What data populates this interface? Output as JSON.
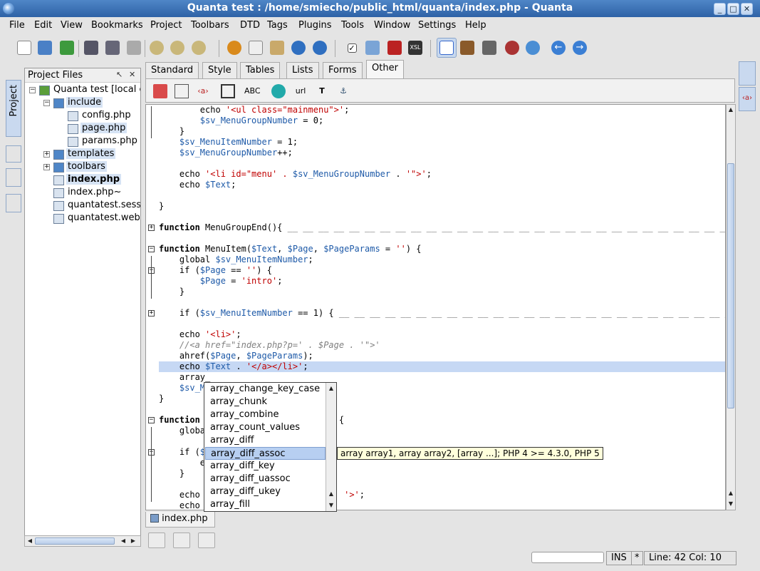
{
  "window": {
    "title": "Quanta test : /home/smiecho/public_html/quanta/index.php - Quanta"
  },
  "menu": [
    "File",
    "Edit",
    "View",
    "Bookmarks",
    "Project",
    "Toolbars",
    "DTD",
    "Tags",
    "Plugins",
    "Tools",
    "Window",
    "Settings",
    "Help"
  ],
  "toolbar": {
    "buttons": [
      "new-file-icon",
      "open-file-icon",
      "open-project-icon",
      "save-icon",
      "save-all-icon",
      "print-icon",
      "find-icon",
      "zoom-in-icon",
      "zoom-out-icon",
      "cut-icon",
      "copy-icon",
      "paste-icon",
      "undo-icon",
      "redo-icon",
      "checkbox-icon",
      "preview-icon",
      "table-icon",
      "xsl-icon",
      "page-icon",
      "view-icon",
      "layout-icon",
      "eye-icon",
      "reload-icon",
      "back-icon",
      "forward-icon"
    ]
  },
  "left_panel": {
    "vertical_tab": "Project",
    "header": "Project Files",
    "tree": [
      {
        "label": "Quanta test [local c",
        "level": 0,
        "expander": "−"
      },
      {
        "label": "include",
        "level": 1,
        "expander": "−"
      },
      {
        "label": "config.php",
        "level": 2
      },
      {
        "label": "page.php",
        "level": 2
      },
      {
        "label": "params.php",
        "level": 2
      },
      {
        "label": "templates",
        "level": 1,
        "expander": "+"
      },
      {
        "label": "toolbars",
        "level": 1,
        "expander": "+"
      },
      {
        "label": "index.php",
        "level": 1,
        "bold": true
      },
      {
        "label": "index.php~",
        "level": 1
      },
      {
        "label": "quantatest.sess",
        "level": 1
      },
      {
        "label": "quantatest.webp",
        "level": 1
      }
    ]
  },
  "tag_tabs": [
    "Standard",
    "Style",
    "Tables",
    "Lists",
    "Forms",
    "Other"
  ],
  "active_tab": "Other",
  "tag_toolbar": [
    "ABC",
    "url",
    "T"
  ],
  "code_lines": [
    [
      [
        "        echo ",
        ""
      ],
      [
        "'<ul class=\"mainmenu\">'",
        "str"
      ],
      [
        ";",
        ""
      ]
    ],
    [
      [
        "        ",
        ""
      ],
      [
        "$sv_MenuGroupNumber",
        "var"
      ],
      [
        " = 0;",
        ""
      ]
    ],
    [
      [
        "    }",
        ""
      ]
    ],
    [
      [
        "    ",
        ""
      ],
      [
        "$sv_MenuItemNumber",
        "var"
      ],
      [
        " = 1;",
        ""
      ]
    ],
    [
      [
        "    ",
        ""
      ],
      [
        "$sv_MenuGroupNumber",
        "var"
      ],
      [
        "++;",
        ""
      ]
    ],
    [
      [
        "",
        ""
      ]
    ],
    [
      [
        "    echo ",
        ""
      ],
      [
        "'<li id=\"menu' . ",
        "str"
      ],
      [
        "$sv_MenuGroupNumber",
        "var"
      ],
      [
        " . ",
        ""
      ],
      [
        "'\">'",
        "str"
      ],
      [
        ";",
        ""
      ]
    ],
    [
      [
        "    echo ",
        ""
      ],
      [
        "$Text",
        "var"
      ],
      [
        ";",
        ""
      ]
    ],
    [
      [
        "",
        ""
      ]
    ],
    [
      [
        "}",
        ""
      ]
    ],
    [
      [
        "",
        ""
      ]
    ],
    [
      [
        "function",
        "kw"
      ],
      [
        " MenuGroupEnd(){",
        ""
      ],
      [
        " __ __ __ __ __ __ __ __ __ __ __ __ __ __ __ __ __ __ __ __ __ __ __ __ __ __ __ __ __ __ __ __",
        "dash"
      ]
    ],
    [
      [
        "",
        ""
      ]
    ],
    [
      [
        "function",
        "kw"
      ],
      [
        " MenuItem(",
        ""
      ],
      [
        "$Text",
        "var"
      ],
      [
        ", ",
        ""
      ],
      [
        "$Page",
        "var"
      ],
      [
        ", ",
        ""
      ],
      [
        "$PageParams",
        "var"
      ],
      [
        " = ",
        ""
      ],
      [
        "''",
        "str"
      ],
      [
        ") {",
        ""
      ]
    ],
    [
      [
        "    global ",
        ""
      ],
      [
        "$sv_MenuItemNumber",
        "var"
      ],
      [
        ";",
        ""
      ]
    ],
    [
      [
        "    if (",
        ""
      ],
      [
        "$Page",
        "var"
      ],
      [
        " == ",
        ""
      ],
      [
        "''",
        "str"
      ],
      [
        ") {",
        ""
      ]
    ],
    [
      [
        "        ",
        ""
      ],
      [
        "$Page",
        "var"
      ],
      [
        " = ",
        ""
      ],
      [
        "'intro'",
        "str"
      ],
      [
        ";",
        ""
      ]
    ],
    [
      [
        "    }",
        ""
      ]
    ],
    [
      [
        "",
        ""
      ]
    ],
    [
      [
        "    if (",
        ""
      ],
      [
        "$sv_MenuItemNumber",
        "var"
      ],
      [
        " == 1) {",
        ""
      ],
      [
        " __ __ __ __ __ __ __ __ __ __ __ __ __ __ __ __ __ __ __ __ __ __ __ __ __ __ __ __",
        "dash"
      ]
    ],
    [
      [
        "",
        ""
      ]
    ],
    [
      [
        "    echo ",
        ""
      ],
      [
        "'<li>'",
        "str"
      ],
      [
        ";",
        ""
      ]
    ],
    [
      [
        "    //<a href=\"index.php?p=' . $Page . '\">'",
        "cmt"
      ]
    ],
    [
      [
        "    ahref(",
        ""
      ],
      [
        "$Page",
        "var"
      ],
      [
        ", ",
        ""
      ],
      [
        "$PageParams",
        "var"
      ],
      [
        ");",
        ""
      ]
    ],
    [
      [
        "    echo ",
        ""
      ],
      [
        "$Text",
        "var"
      ],
      [
        " . ",
        ""
      ],
      [
        "'</a></li>'",
        "str"
      ],
      [
        ";",
        ""
      ]
    ],
    [
      [
        "    array_",
        ""
      ]
    ],
    [
      [
        "    ",
        ""
      ],
      [
        "$sv_Me",
        "var"
      ]
    ],
    [
      [
        "}",
        ""
      ]
    ],
    [
      [
        "",
        ""
      ]
    ],
    [
      [
        "function",
        "kw"
      ],
      [
        "                           {",
        ""
      ]
    ],
    [
      [
        "    global",
        ""
      ]
    ],
    [
      [
        "",
        ""
      ]
    ],
    [
      [
        "    if (",
        ""
      ],
      [
        "$s",
        "var"
      ]
    ],
    [
      [
        "        echo",
        ""
      ]
    ],
    [
      [
        "    }",
        ""
      ]
    ],
    [
      [
        "",
        ""
      ]
    ],
    [
      [
        "    echo ",
        ""
      ],
      [
        "'",
        "str"
      ],
      [
        "                          ",
        ""
      ],
      [
        "'>'",
        "str"
      ],
      [
        ";",
        ""
      ]
    ],
    [
      [
        "    echo ",
        ""
      ],
      [
        "$",
        "var"
      ]
    ]
  ],
  "completion": {
    "items": [
      "array_change_key_case",
      "array_chunk",
      "array_combine",
      "array_count_values",
      "array_diff",
      "array_diff_assoc",
      "array_diff_key",
      "array_diff_uassoc",
      "array_diff_ukey",
      "array_fill"
    ],
    "selected_index": 5,
    "tooltip": "array array1, array array2, [array  ...]; PHP 4 >= 4.3.0, PHP 5"
  },
  "document_tab": "index.php",
  "statusbar": {
    "ins": "INS",
    "modified": "*",
    "position": "Line: 42 Col: 10"
  }
}
